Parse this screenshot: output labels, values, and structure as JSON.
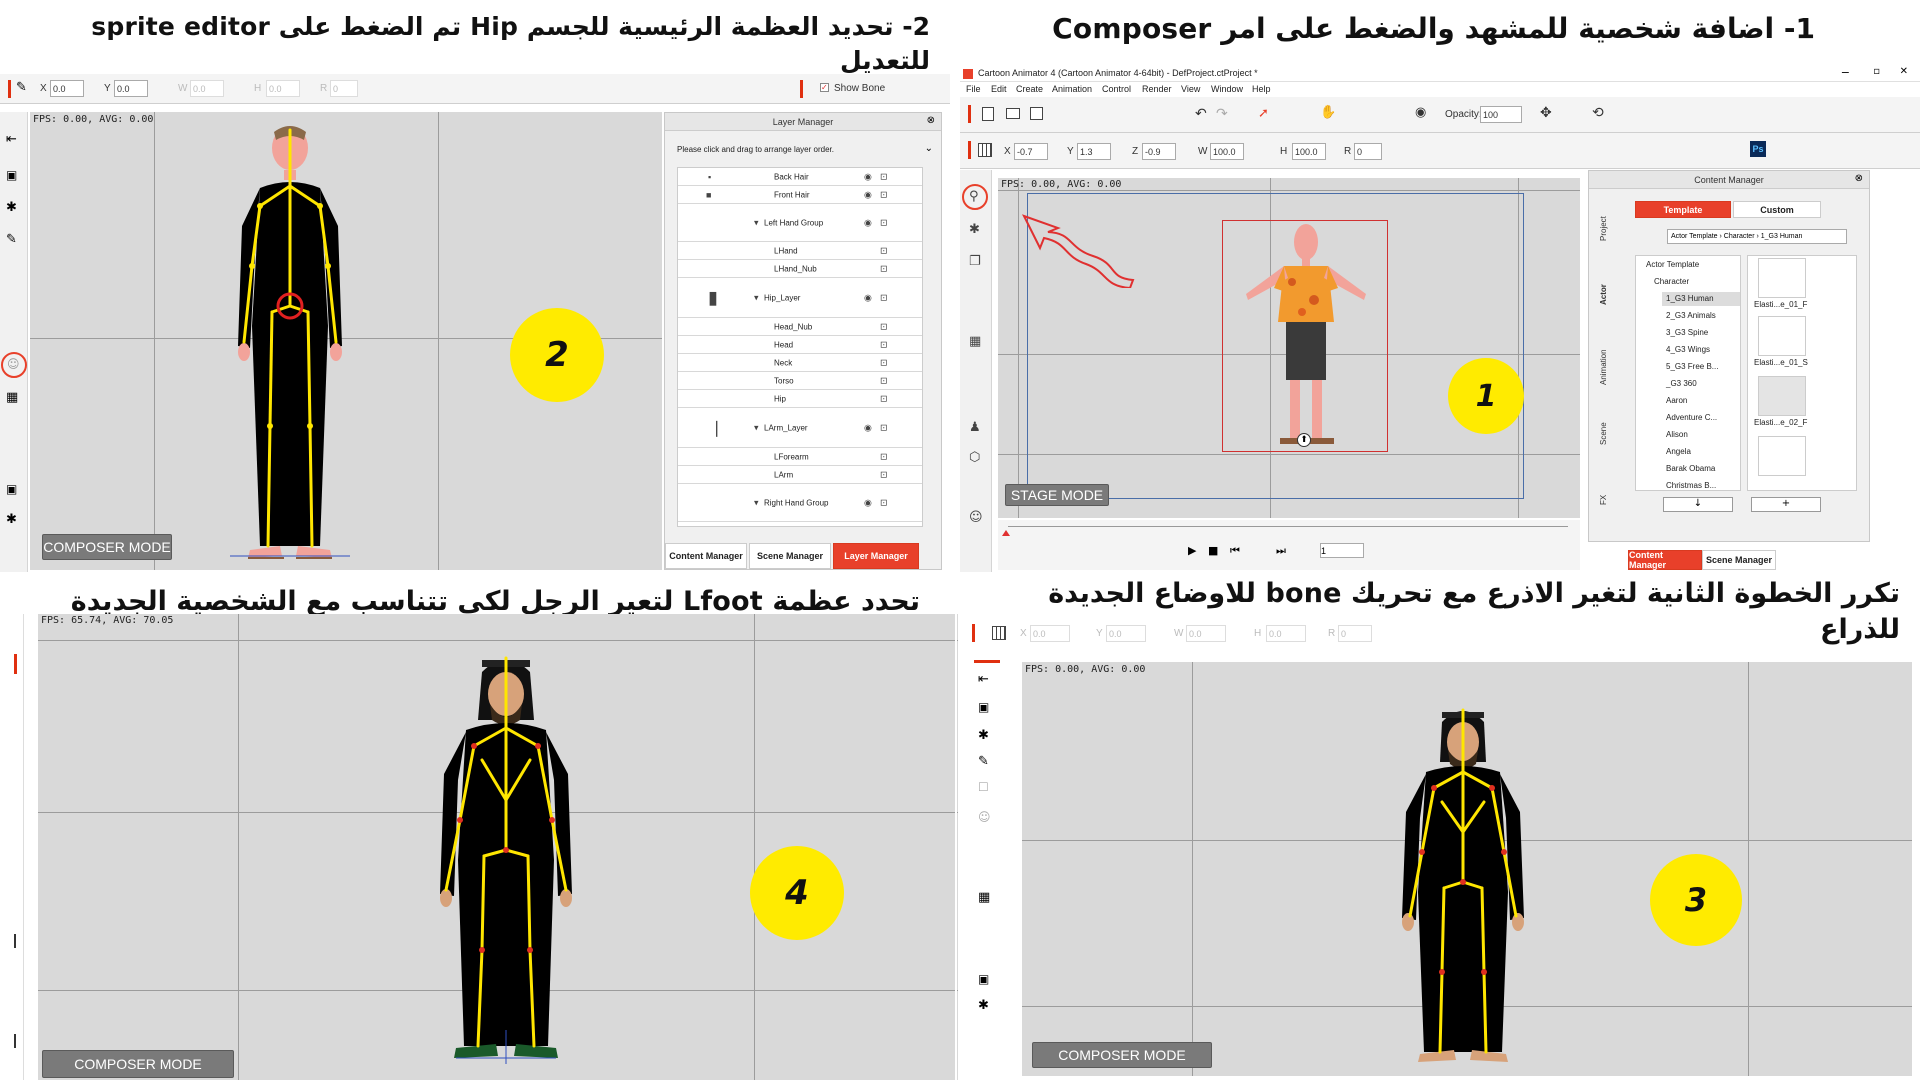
{
  "captions": {
    "q1": "1- اضافة شخصية للمشهد والضغط على امر Composer",
    "q2_line1": "2- تحديد العظمة الرئيسية للجسم Hip تم الضغط على sprite editor",
    "q2_line2": "للتعديل",
    "q3_line1": "تكرر الخطوة الثانية لتغير الاذرع مع تحريك bone للاوضاع الجديدة",
    "q3_line2": "للذراع",
    "q4": "تحدد عظمة Lfoot لتعير الرجل لكى تتناسب مع الشخصية الجديدة"
  },
  "step_numbers": {
    "s1": "1",
    "s2": "2",
    "s3": "3",
    "s4": "4"
  },
  "app": {
    "title": "Cartoon Animator 4 (Cartoon Animator 4-64bit) - DefProject.ctProject *",
    "menu": [
      "File",
      "Edit",
      "Create",
      "Animation",
      "Control",
      "Render",
      "View",
      "Window",
      "Help"
    ],
    "opacity_label": "Opacity:",
    "opacity_value": "100",
    "ps_label": "Ps"
  },
  "transform_q1": {
    "x": "-0.7",
    "y": "1.3",
    "z": "-0.9",
    "w": "100.0",
    "h": "100.0",
    "r": "0"
  },
  "transform_q2": {
    "x": "0.0",
    "y": "0.0",
    "w": "0.0",
    "h": "0.0",
    "r": "0",
    "show_bone": "Show Bone"
  },
  "transform_q3": {
    "x": "0.0",
    "y": "0.0",
    "w": "0.0",
    "h": "0.0",
    "r": "0"
  },
  "labels": {
    "x": "X",
    "y": "Y",
    "z": "Z",
    "w": "W",
    "h": "H",
    "r": "R"
  },
  "fps": {
    "q1": "FPS: 0.00, AVG: 0.00",
    "q2": "FPS: 0.00, AVG: 0.00",
    "q3": "FPS: 0.00, AVG: 0.00",
    "q4": "FPS: 65.74, AVG: 70.05"
  },
  "modes": {
    "stage": "STAGE MODE",
    "composer": "COMPOSER MODE"
  },
  "timeline": {
    "frame": "1"
  },
  "content_manager": {
    "title": "Content Manager",
    "tabs": [
      "Template",
      "Custom"
    ],
    "path": [
      "Actor Template",
      "Character",
      "1_G3 Human"
    ],
    "side_tabs": [
      "Project",
      "Actor",
      "Animation",
      "Scene",
      "FX"
    ],
    "tree": [
      "Actor Template",
      "Character",
      "1_G3 Human",
      "2_G3 Animals",
      "3_G3 Spine",
      "4_G3 Wings",
      "5_G3 Free B...",
      "_G3 360",
      "Aaron",
      "Adventure C...",
      "Alison",
      "Angela",
      "Barak Obama",
      "Christmas B..."
    ],
    "thumbs": [
      "Elasti...e_01_F",
      "Elasti...e_01_S",
      "Elasti...e_02_F",
      ""
    ],
    "bottom_tabs": [
      "Content Manager",
      "Scene Manager"
    ]
  },
  "layer_manager": {
    "title": "Layer Manager",
    "hint": "Please click and drag to arrange layer order.",
    "rows": [
      "Back Hair",
      "Front Hair",
      "Left Hand Group",
      "LHand",
      "LHand_Nub",
      "Hip_Layer",
      "Head_Nub",
      "Head",
      "Neck",
      "Torso",
      "Hip",
      "LArm_Layer",
      "LForearm",
      "LArm",
      "Right Hand Group"
    ],
    "bottom_tabs": [
      "Content Manager",
      "Scene Manager",
      "Layer Manager"
    ]
  },
  "colors": {
    "accent": "#e8402a",
    "circle": "#ffeb00",
    "bone": "#ffe600"
  }
}
